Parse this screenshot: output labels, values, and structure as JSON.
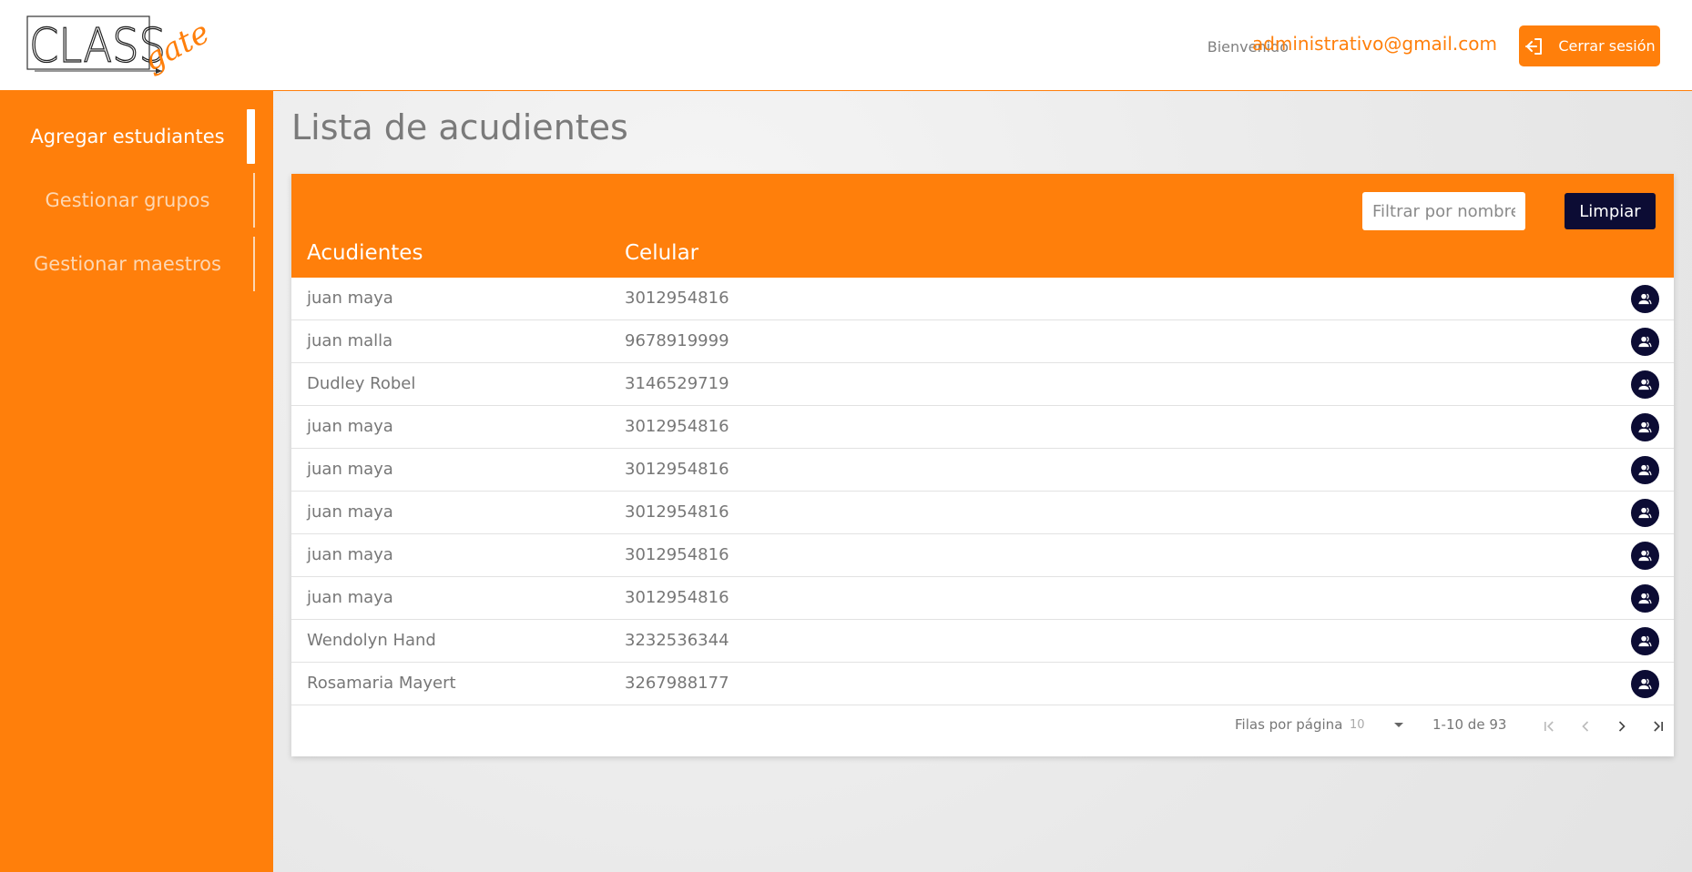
{
  "header": {
    "logo_text_main": "CLASS",
    "logo_text_script": "gate",
    "welcome_label": "Bienvenido",
    "user_email": "administrativo@gmail.com",
    "logout_label": "Cerrar sesión",
    "logout_icon": "logout-icon"
  },
  "sidebar": {
    "items": [
      {
        "label": "Agregar estudiantes",
        "active": true
      },
      {
        "label": "Gestionar grupos",
        "active": false
      },
      {
        "label": "Gestionar maestros",
        "active": false
      }
    ]
  },
  "main": {
    "title": "Lista de acudientes",
    "filter_placeholder": "Filtrar por nombre...",
    "filter_value": "",
    "clear_label": "Limpiar",
    "columns": [
      "Acudientes",
      "Celular"
    ],
    "row_action_icon": "guardian-user-icon",
    "rows": [
      {
        "name": "juan maya",
        "phone": "3012954816"
      },
      {
        "name": "juan malla",
        "phone": "9678919999"
      },
      {
        "name": "Dudley Robel",
        "phone": "3146529719"
      },
      {
        "name": "juan maya",
        "phone": "3012954816"
      },
      {
        "name": "juan maya",
        "phone": "3012954816"
      },
      {
        "name": "juan maya",
        "phone": "3012954816"
      },
      {
        "name": "juan maya",
        "phone": "3012954816"
      },
      {
        "name": "juan maya",
        "phone": "3012954816"
      },
      {
        "name": "Wendolyn Hand",
        "phone": "3232536344"
      },
      {
        "name": "Rosamaria Mayert",
        "phone": "3267988177"
      }
    ],
    "pagination": {
      "rows_per_page_label": "Filas por página",
      "rows_per_page_value": "10",
      "range_label": "1-10 de 93"
    }
  },
  "colors": {
    "accent": "#ff7f0b",
    "dark_button": "#0c0c34",
    "background": "#ececec"
  }
}
